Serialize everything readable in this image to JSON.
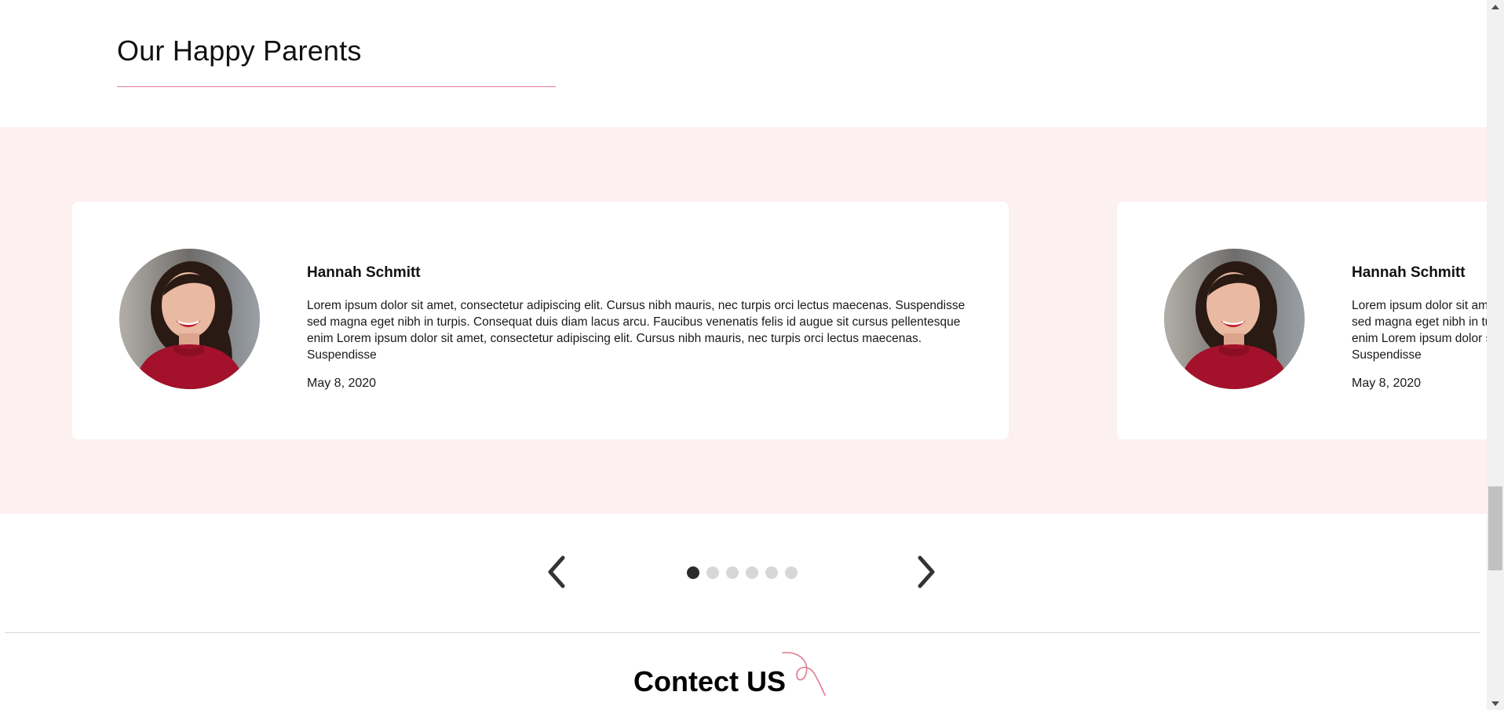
{
  "section": {
    "title": "Our Happy Parents"
  },
  "testimonials": [
    {
      "name": "Hannah Schmitt",
      "text": "Lorem ipsum dolor sit amet, consectetur adipiscing elit. Cursus nibh mauris, nec turpis orci lectus maecenas. Suspendisse sed magna eget nibh in turpis. Consequat duis diam lacus arcu. Faucibus venenatis felis id augue sit cursus pellentesque enim Lorem ipsum dolor sit amet, consectetur adipiscing elit. Cursus nibh mauris, nec turpis orci lectus maecenas. Suspendisse",
      "date": "May 8, 2020"
    },
    {
      "name": "Hannah Schmitt",
      "text": "Lorem ipsum dolor sit amet, consectetur adipiscing elit. Cursus nibh mauris, nec turpis orci lectus maecenas. Suspendisse sed magna eget nibh in turpis. Consequat duis diam lacus arcu. Faucibus venenatis felis id augue sit cursus pellentesque enim Lorem ipsum dolor sit amet, consectetur adipiscing elit. Cursus nibh mauris, nec turpis orci lectus maecenas. Suspendisse",
      "date": "May 8, 2020"
    }
  ],
  "carousel": {
    "prev_icon": "chevron-left-icon",
    "next_icon": "chevron-right-icon",
    "dot_count": 6,
    "active_index": 0
  },
  "contact": {
    "title": "Contect US"
  },
  "colors": {
    "accent": "#e07a90",
    "band_background": "#fdf0f0",
    "dot_active": "#2b2b2b",
    "dot_inactive": "#d7d7d7"
  }
}
